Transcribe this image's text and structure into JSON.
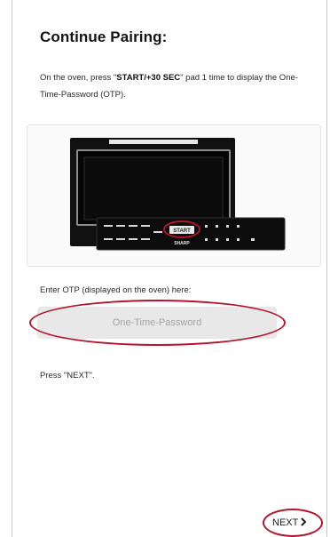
{
  "page": {
    "title": "Continue Pairing:",
    "instruction_prefix": "On the oven, press \"",
    "instruction_key": "START/+30 SEC",
    "instruction_suffix": "\" pad 1 time to display the One-Time-Password (OTP).",
    "otp_label": "Enter OTP (displayed on the oven) here:",
    "otp_placeholder": "One-Time-Password",
    "otp_value": "",
    "press_next_text": "Press \"NEXT\".",
    "next_label": "NEXT"
  },
  "oven_image": {
    "brand_label": "SHARP",
    "highlighted_key": "START"
  },
  "icons": {
    "next": "chevron-right-icon"
  },
  "colors": {
    "highlight": "#b3142e",
    "input_background": "#e8e8e8",
    "placeholder": "#a3a3a3",
    "oven_body": "#111111"
  }
}
